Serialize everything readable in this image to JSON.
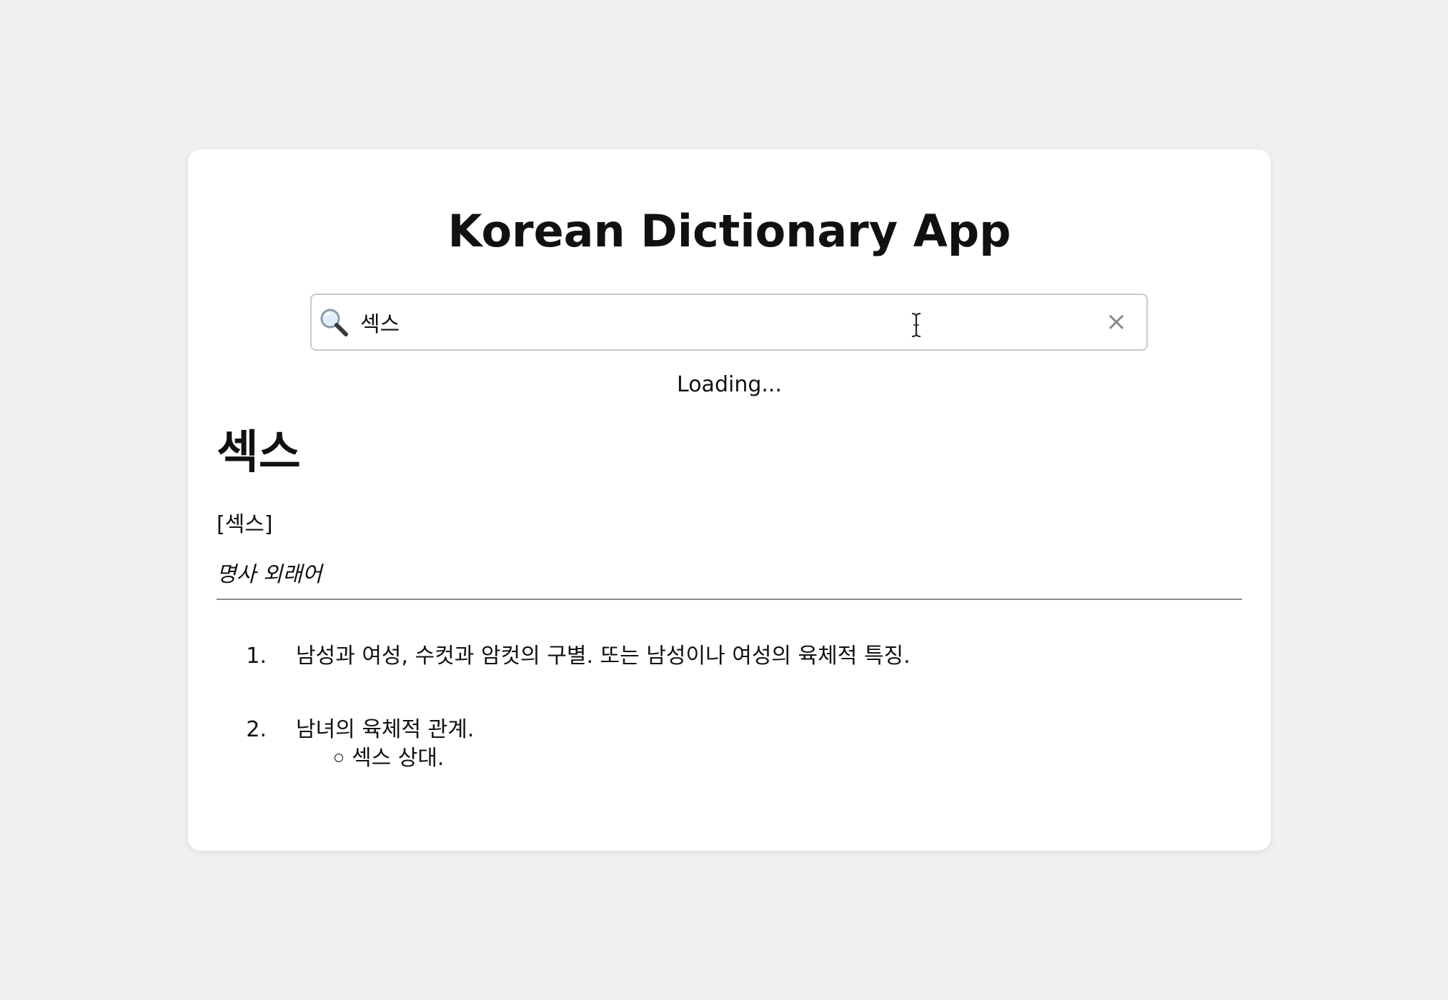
{
  "app": {
    "title": "Korean Dictionary App"
  },
  "search": {
    "value": "섹스",
    "placeholder": "",
    "clear_label": "×",
    "icon": "magnifying-glass-icon"
  },
  "status": {
    "loading_text": "Loading..."
  },
  "entry": {
    "word": "섹스",
    "pronunciation": "[섹스]",
    "part_of_speech": "명사 외래어",
    "definitions": [
      {
        "number": "1.",
        "text": "남성과 여성, 수컷과 암컷의 구별. 또는 남성이나 여성의 육체적 특징."
      },
      {
        "number": "2.",
        "text": "남녀의 육체적 관계.",
        "examples": [
          "섹스 상대."
        ]
      }
    ]
  }
}
